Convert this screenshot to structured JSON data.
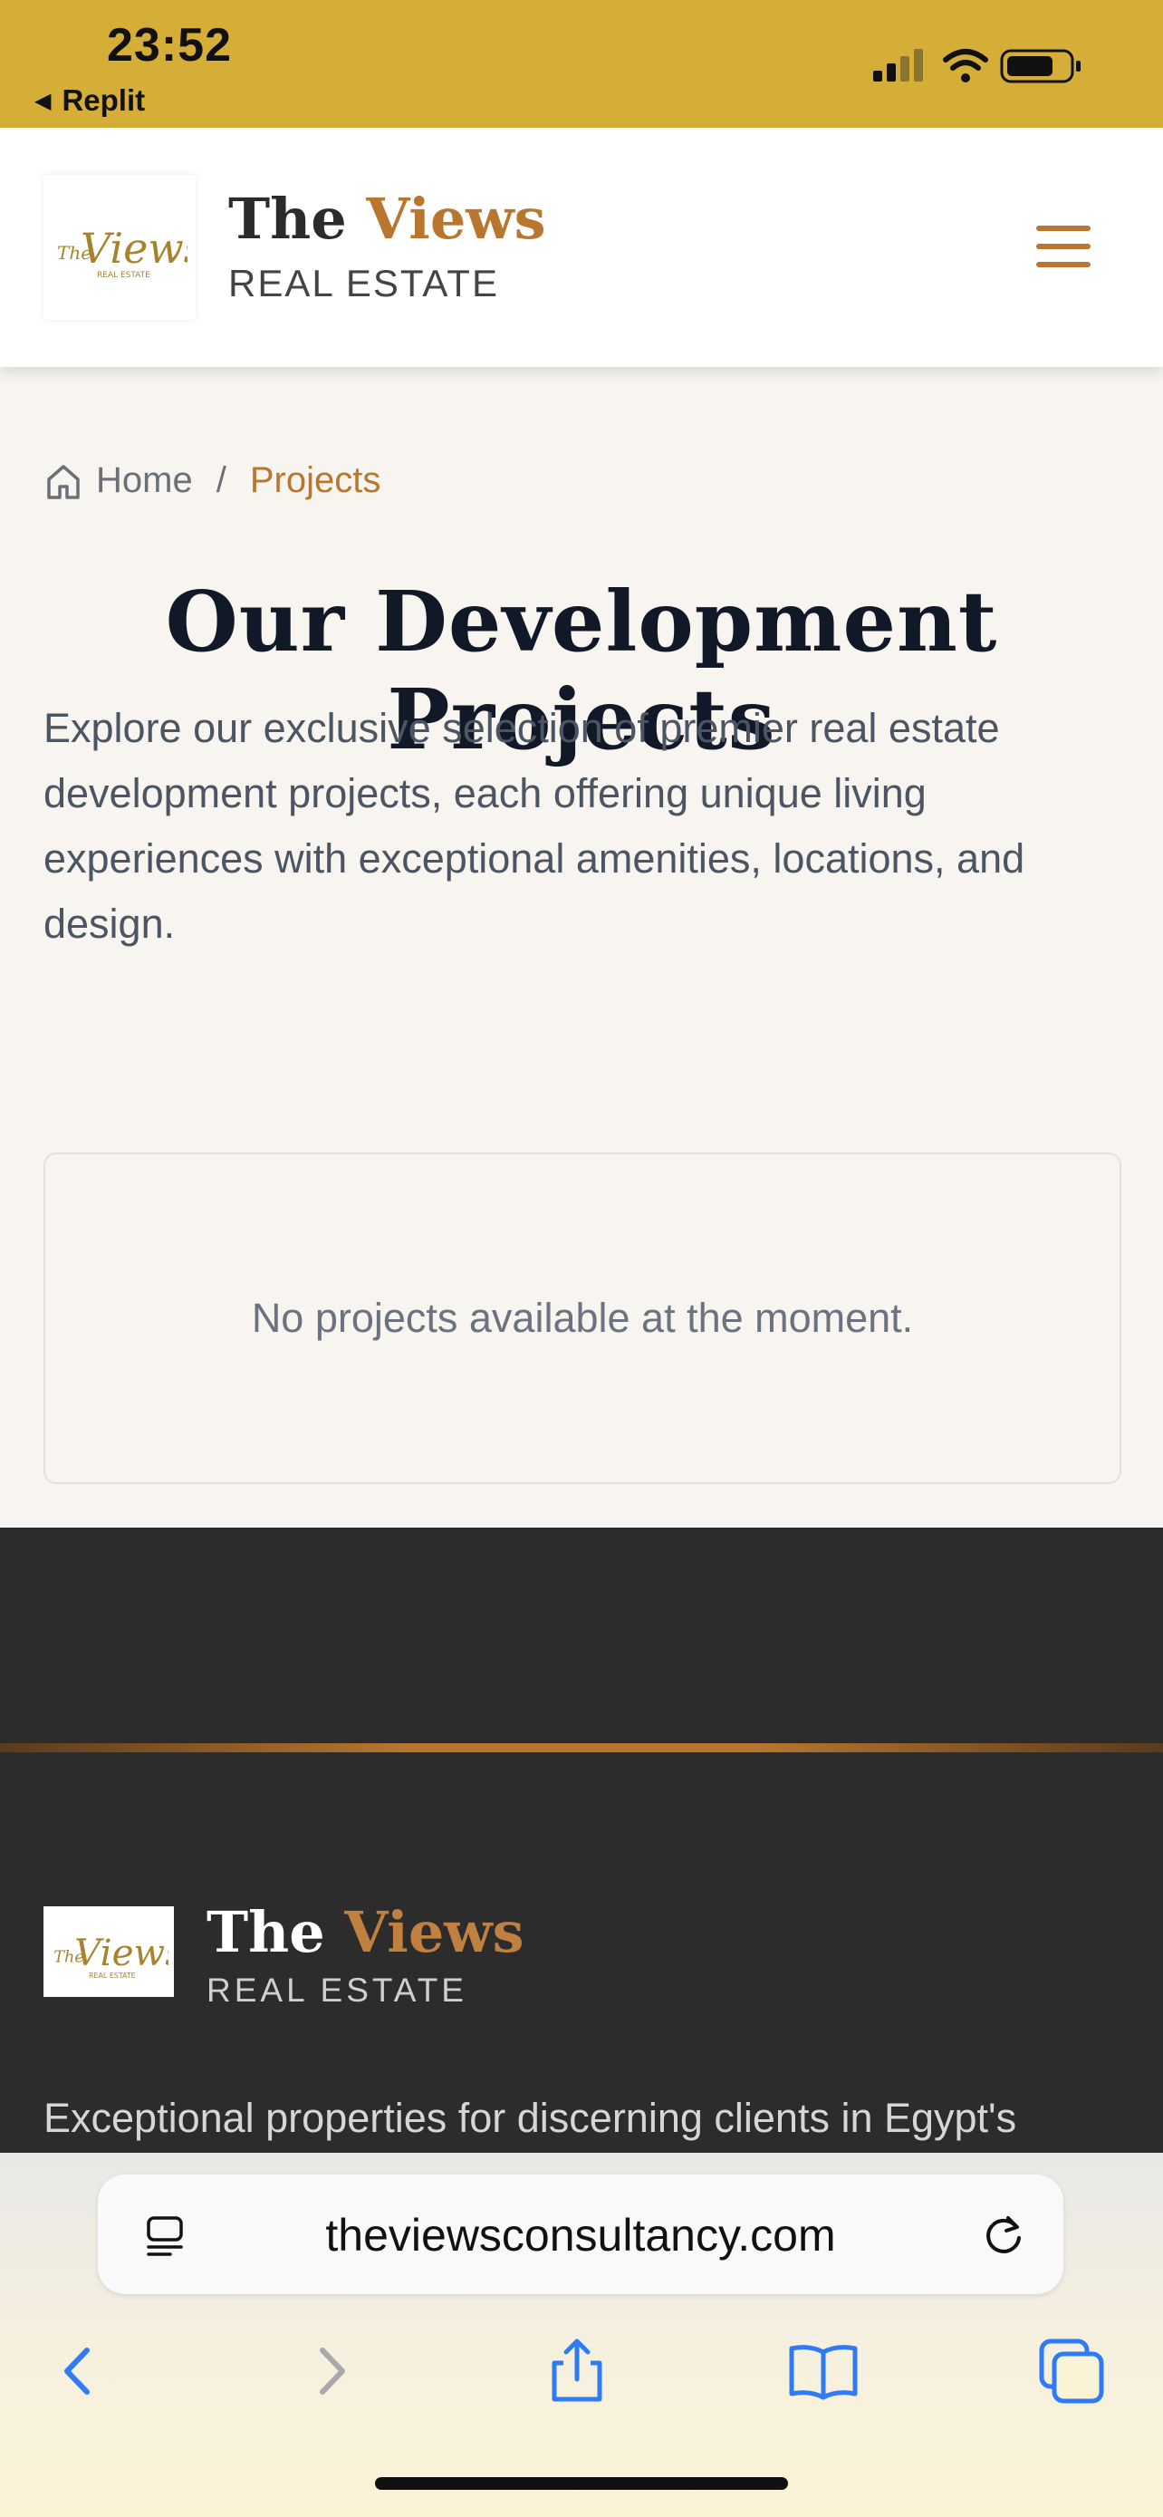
{
  "status_bar": {
    "time": "23:52",
    "back_app": "Replit",
    "icons": [
      "cellular-signal-icon",
      "wifi-icon",
      "battery-icon"
    ]
  },
  "header": {
    "logo_icon": "the-views-logo",
    "brand_the": "The",
    "brand_views": "Views",
    "brand_sub": "REAL ESTATE",
    "menu_icon": "hamburger-menu-icon"
  },
  "breadcrumb": {
    "home": "Home",
    "separator": "/",
    "current": "Projects"
  },
  "page": {
    "title": "Our Development Projects",
    "description": "Explore our exclusive selection of premier real estate development projects, each offering unique living experiences with exceptional amenities, locations, and design.",
    "empty_message": "No projects available at the moment."
  },
  "footer": {
    "brand_the": "The",
    "brand_views": "Views",
    "brand_sub": "REAL ESTATE",
    "tagline": "Exceptional properties for discerning clients in Egypt's"
  },
  "browser": {
    "url": "theviewsconsultancy.com",
    "toolbar": [
      "back-icon",
      "forward-icon",
      "share-icon",
      "bookmarks-icon",
      "tabs-icon"
    ]
  },
  "colors": {
    "status_bar": "#d4ae36",
    "accent": "#b8762f",
    "footer_bg": "#2c2c2c",
    "page_bg": "#f8f5f0"
  }
}
